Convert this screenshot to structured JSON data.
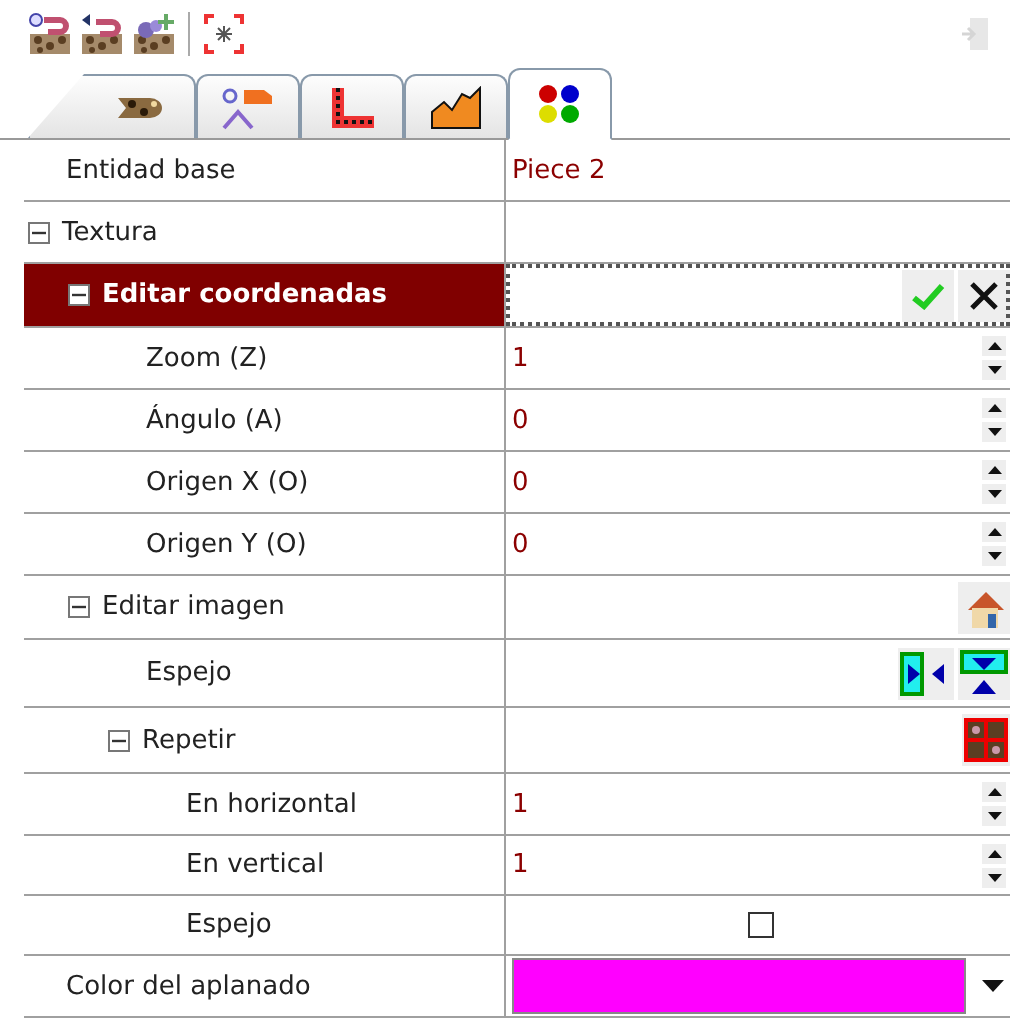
{
  "toolbar": {
    "tools": [
      {
        "kind": "info-piece",
        "disabled": false
      },
      {
        "kind": "back-piece",
        "disabled": false
      },
      {
        "kind": "add-piece",
        "disabled": false
      },
      {
        "kind": "sep"
      },
      {
        "kind": "focus",
        "disabled": false
      },
      {
        "kind": "exit",
        "disabled": true
      }
    ]
  },
  "tabs": [
    {
      "kind": "texture",
      "selected": false
    },
    {
      "kind": "node",
      "selected": false
    },
    {
      "kind": "path",
      "selected": false
    },
    {
      "kind": "terrain",
      "selected": false
    },
    {
      "kind": "colors",
      "selected": true
    }
  ],
  "properties": [
    {
      "label": "Entidad base",
      "selected": false,
      "value": {
        "kind": "text",
        "text": "Piece 2"
      }
    },
    {
      "label": "Textura",
      "selected": false,
      "expanded": true,
      "children": [
        {
          "label": "Editar coordenadas",
          "selected": true,
          "expanded": true,
          "value": {
            "kind": "confirm"
          },
          "children": [
            {
              "label": "Zoom (Z)",
              "selected": false,
              "value": {
                "kind": "spin",
                "text": "1"
              }
            },
            {
              "label": "Ángulo (A)",
              "selected": false,
              "value": {
                "kind": "spin",
                "text": "0"
              }
            },
            {
              "label": "Origen X (O)",
              "selected": false,
              "value": {
                "kind": "spin",
                "text": "0"
              }
            },
            {
              "label": "Origen Y (O)",
              "selected": false,
              "value": {
                "kind": "spin",
                "text": "0"
              }
            }
          ]
        },
        {
          "label": "Editar imagen",
          "selected": false,
          "expanded": true,
          "value": {
            "kind": "house"
          },
          "children": [
            {
              "label": "Espejo",
              "selected": false,
              "value": {
                "kind": "mirror"
              }
            },
            {
              "label": "Repetir",
              "selected": false,
              "expanded": true,
              "value": {
                "kind": "tile"
              },
              "children": [
                {
                  "label": "En horizontal",
                  "selected": false,
                  "value": {
                    "kind": "spin",
                    "text": "1"
                  }
                },
                {
                  "label": "En vertical",
                  "selected": false,
                  "value": {
                    "kind": "spin",
                    "text": "1"
                  }
                },
                {
                  "label": "Espejo",
                  "selected": false,
                  "value": {
                    "kind": "checkbox",
                    "checked": false
                  }
                }
              ]
            }
          ]
        }
      ]
    },
    {
      "label": "Color del aplanado",
      "selected": false,
      "value": {
        "kind": "color",
        "color": "#ff00ff"
      }
    }
  ]
}
